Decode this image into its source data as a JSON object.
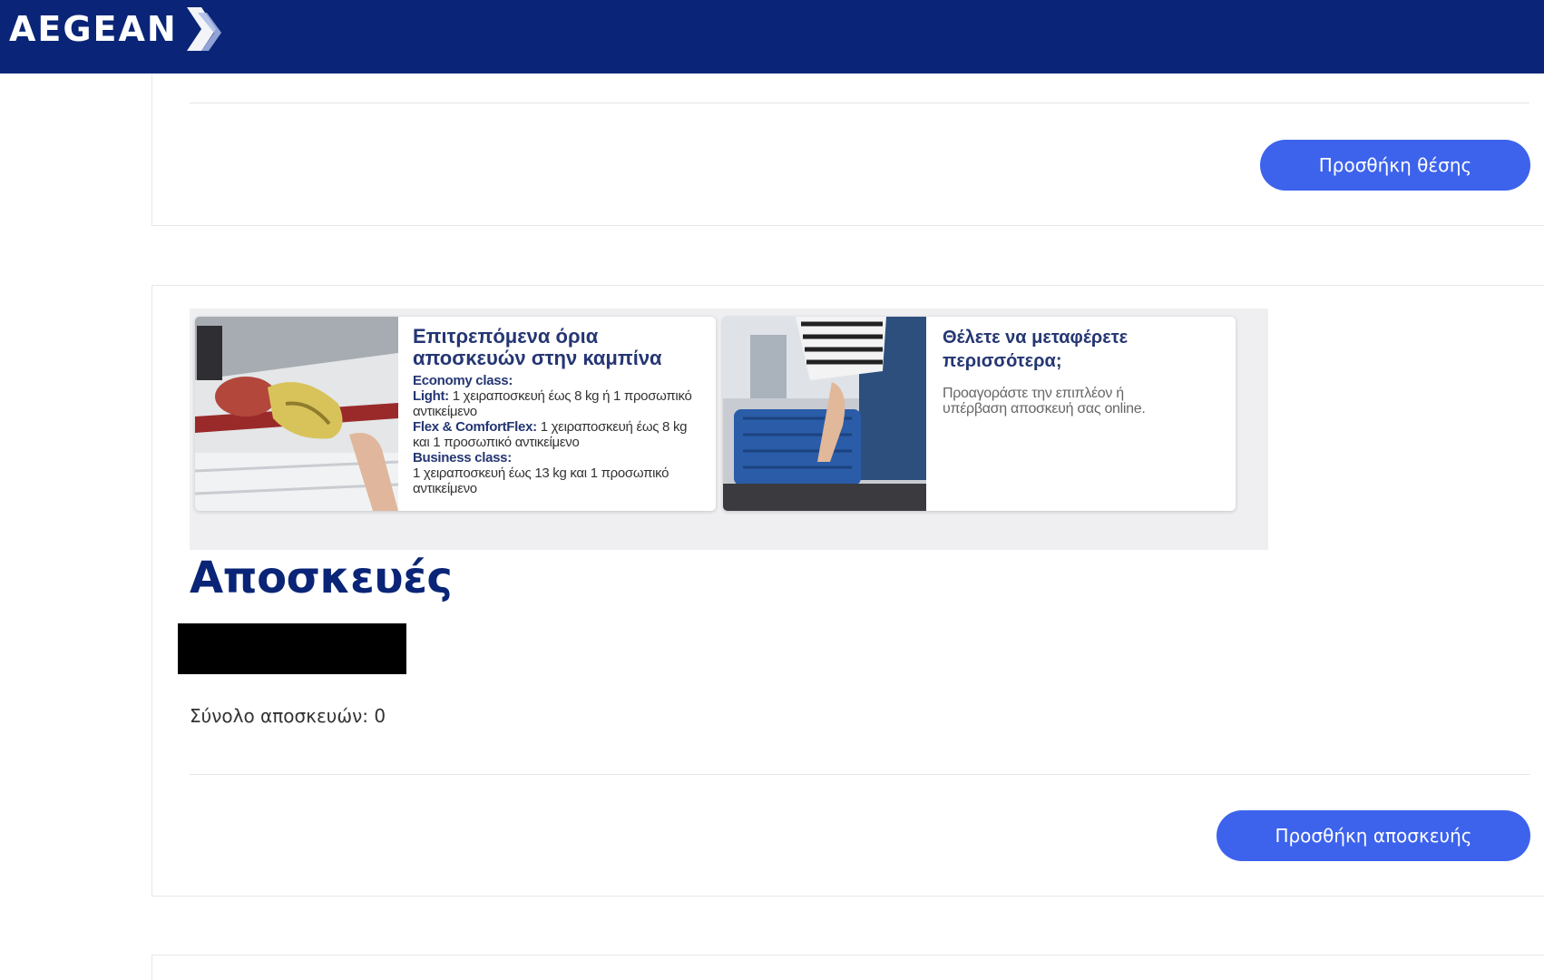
{
  "header": {
    "logo_text": "AEGEAN",
    "background": "#0a2577"
  },
  "seats": {
    "add_button": "Προσθήκη θέσης"
  },
  "promo": {
    "card1": {
      "title_line1": "Επιτρεπόμενα όρια",
      "title_line2": "αποσκευών στην καμπίνα",
      "economy_heading": "Economy class:",
      "light_label": "Light:",
      "light_text_1": " 1 χειραποσκευή έως 8 kg ή 1 προσωπικό",
      "light_text_2": "αντικείμενο",
      "flex_label": "Flex & ComfortFlex:",
      "flex_text_1": " 1 χειραποσκευή έως 8 kg",
      "flex_text_2": "και 1 προσωπικό αντικείμενο",
      "business_heading": "Business class:",
      "business_text_1": "1 χειραποσκευή έως 13 kg και 1 προσωπικό",
      "business_text_2": "αντικείμενο"
    },
    "card2": {
      "title_line1": "Θέλετε να μεταφέρετε",
      "title_line2": "περισσότερα;",
      "text_line1": "Προαγοράστε την επιπλέον ή",
      "text_line2": "υπέρβαση αποσκευή σας online."
    }
  },
  "baggage": {
    "title": "Αποσκευές",
    "total_label": "Σύνολο αποσκευών: 0",
    "add_button": "Προσθήκη αποσκευής"
  },
  "colors": {
    "primary_button": "#3d63ec",
    "navy": "#0a2577",
    "card_title": "#253673"
  }
}
